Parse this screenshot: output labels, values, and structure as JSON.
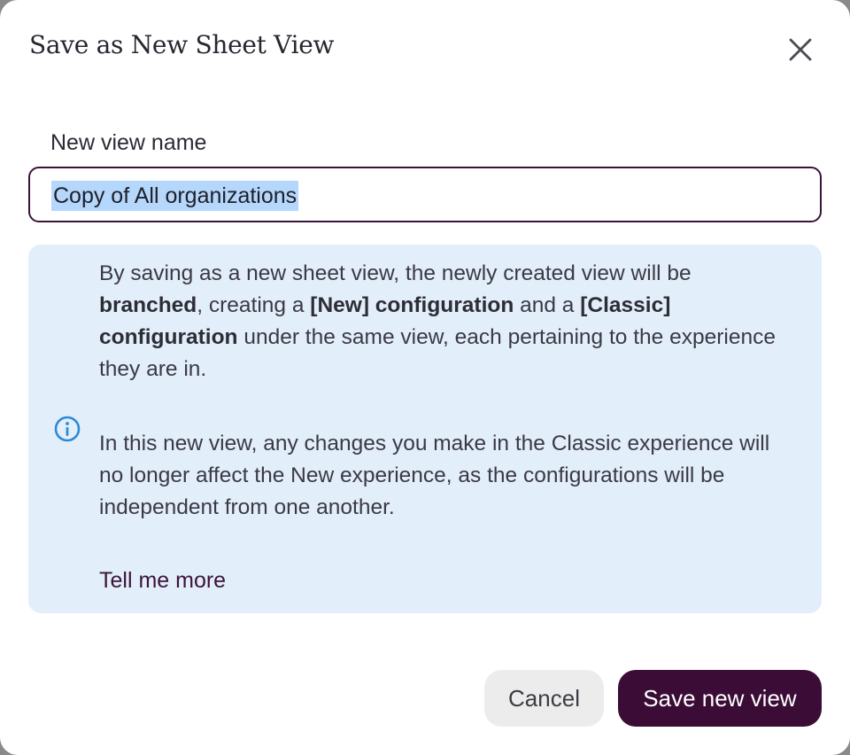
{
  "dialog": {
    "title": "Save as New Sheet View",
    "close_icon": "close-icon",
    "field_label": "New view name",
    "field_value": "Copy of All organizations",
    "info": {
      "icon": "info-icon",
      "p1_part1": "By saving as a new sheet view, the newly created view will be ",
      "p1_bold1": "branched",
      "p1_part2": ", creating a ",
      "p1_bold2": "[New] configuration",
      "p1_part3": " and a ",
      "p1_bold3": "[Classic] configuration",
      "p1_part4": " under the same view, each pertaining to the experience they are in.",
      "p2": "In this new view, any changes you make in the Classic experience will no longer affect the New experience, as the configurations will be independent from one another.",
      "link": "Tell me more",
      "accent_color": "#2b8bd8"
    },
    "cancel_label": "Cancel",
    "save_label": "Save new view",
    "colors": {
      "primary": "#3a0c36",
      "info_bg": "#e3eefb",
      "selection": "#b4d7fb"
    }
  }
}
